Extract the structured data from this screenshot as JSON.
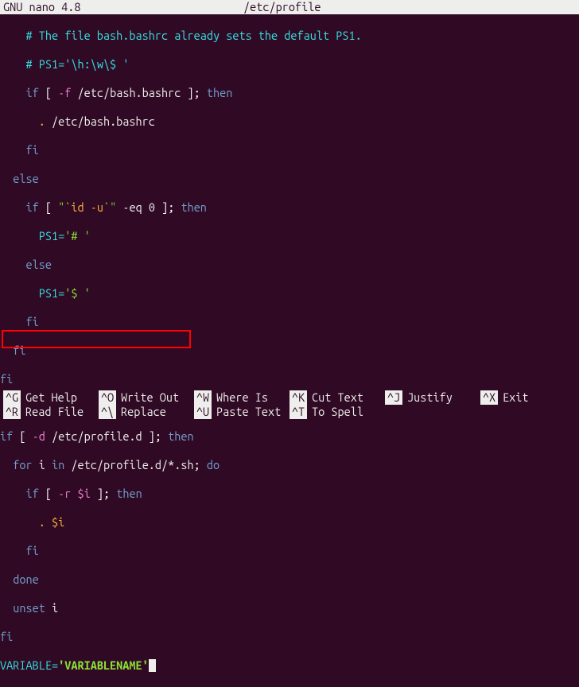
{
  "titlebar": {
    "app": "GNU nano 4.8",
    "filename": "/etc/profile"
  },
  "code": {
    "l1_comment": "# The file bash.bashrc already sets the default PS1.",
    "l2a": "# PS1=",
    "l2b": "'\\h:\\w\\$ '",
    "l3_if": "if",
    "l3_br1": " [ ",
    "l3_opt": "-f",
    "l3_path": " /etc/bash.bashrc ",
    "l3_br2": "]",
    "l3_semi": ";",
    "l3_then": " then",
    "l4_dot": ". ",
    "l4_path": "/etc/bash.bashrc",
    "l5_fi": "fi",
    "l6_else": "else",
    "l7_if": "if",
    "l7_br1": " [ ",
    "l7_q1": "\"",
    "l7_tick": "`",
    "l7_id": "id -u",
    "l7_tick2": "`",
    "l7_q2": "\"",
    "l7_eq": " -eq ",
    "l7_zero": "0",
    "l7_br2": " ]",
    "l7_semi": ";",
    "l7_then": " then",
    "l8a": "PS1=",
    "l8b": "'# '",
    "l9_else": "else",
    "l10a": "PS1=",
    "l10b": "'$ '",
    "l11_fi": "fi",
    "l12_fi": "fi",
    "l13_fi": "fi",
    "l15_if": "if",
    "l15_br1": " [ ",
    "l15_opt": "-d",
    "l15_path": " /etc/profile.d ",
    "l15_br2": "]",
    "l15_semi": ";",
    "l15_then": " then",
    "l16_for": "for",
    "l16_i": " i ",
    "l16_in": "in",
    "l16_path": " /etc/profile.d/*.sh",
    "l16_semi": ";",
    "l16_do": " do",
    "l17_if": "if",
    "l17_br1": " [ ",
    "l17_opt": "-r",
    "l17_var": " $i",
    "l17_br2": " ]",
    "l17_semi": ";",
    "l17_then": " then",
    "l18_dot": ". ",
    "l18_var": "$i",
    "l19_fi": "fi",
    "l20_done": "done",
    "l21_unset": "unset",
    "l21_i": " i",
    "l22_fi": "fi",
    "l23_var": "VARIABLE=",
    "l23_val": "'VARIABLENAME'"
  },
  "shortcuts": [
    {
      "key": "^G",
      "label": "Get Help"
    },
    {
      "key": "^O",
      "label": "Write Out"
    },
    {
      "key": "^W",
      "label": "Where Is"
    },
    {
      "key": "^K",
      "label": "Cut Text"
    },
    {
      "key": "^J",
      "label": "Justify"
    },
    {
      "key": "^X",
      "label": "Exit"
    },
    {
      "key": "^R",
      "label": "Read File"
    },
    {
      "key": "^\\",
      "label": "Replace"
    },
    {
      "key": "^U",
      "label": "Paste Text"
    },
    {
      "key": "^T",
      "label": "To Spell"
    }
  ]
}
